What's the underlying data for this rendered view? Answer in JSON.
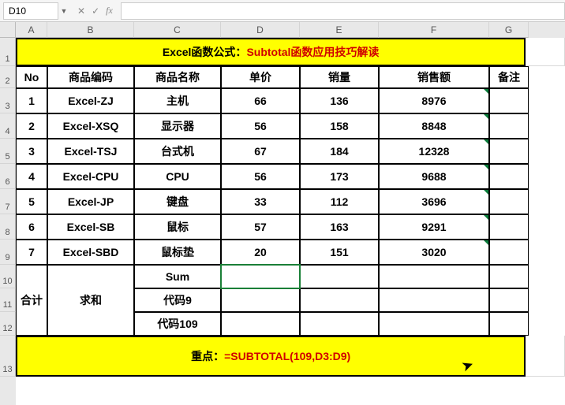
{
  "nameBox": "D10",
  "formulaBarValue": "",
  "cols": [
    "A",
    "B",
    "C",
    "D",
    "E",
    "F",
    "G"
  ],
  "rows": [
    "1",
    "2",
    "3",
    "4",
    "5",
    "6",
    "7",
    "8",
    "9",
    "10",
    "11",
    "12",
    "13"
  ],
  "title": {
    "black": "Excel函数公式：",
    "red": "Subtotal函数应用技巧解读"
  },
  "headers": {
    "no": "No",
    "code": "商品编码",
    "name": "商品名称",
    "price": "单价",
    "qty": "销量",
    "sales": "销售额",
    "remark": "备注"
  },
  "data": [
    {
      "no": "1",
      "code": "Excel-ZJ",
      "name": "主机",
      "price": "66",
      "qty": "136",
      "sales": "8976"
    },
    {
      "no": "2",
      "code": "Excel-XSQ",
      "name": "显示器",
      "price": "56",
      "qty": "158",
      "sales": "8848"
    },
    {
      "no": "3",
      "code": "Excel-TSJ",
      "name": "台式机",
      "price": "67",
      "qty": "184",
      "sales": "12328"
    },
    {
      "no": "4",
      "code": "Excel-CPU",
      "name": "CPU",
      "price": "56",
      "qty": "173",
      "sales": "9688"
    },
    {
      "no": "5",
      "code": "Excel-JP",
      "name": "键盘",
      "price": "33",
      "qty": "112",
      "sales": "3696"
    },
    {
      "no": "6",
      "code": "Excel-SB",
      "name": "鼠标",
      "price": "57",
      "qty": "163",
      "sales": "9291"
    },
    {
      "no": "7",
      "code": "Excel-SBD",
      "name": "鼠标垫",
      "price": "20",
      "qty": "151",
      "sales": "3020"
    }
  ],
  "sumBlock": {
    "merged1": "合计",
    "merged2": "求和",
    "row1": "Sum",
    "row2": "代码9",
    "row3": "代码109"
  },
  "footer": {
    "black": "重点：",
    "red": "=SUBTOTAL(109,D3:D9)"
  },
  "icons": {
    "cancel": "✕",
    "confirm": "✓",
    "fx": "fx"
  },
  "chart_data": {
    "type": "table",
    "title": "Excel函数公式：Subtotal函数应用技巧解读",
    "columns": [
      "No",
      "商品编码",
      "商品名称",
      "单价",
      "销量",
      "销售额",
      "备注"
    ],
    "rows": [
      [
        "1",
        "Excel-ZJ",
        "主机",
        66,
        136,
        8976,
        ""
      ],
      [
        "2",
        "Excel-XSQ",
        "显示器",
        56,
        158,
        8848,
        ""
      ],
      [
        "3",
        "Excel-TSJ",
        "台式机",
        67,
        184,
        12328,
        ""
      ],
      [
        "4",
        "Excel-CPU",
        "CPU",
        56,
        173,
        9688,
        ""
      ],
      [
        "5",
        "Excel-JP",
        "键盘",
        33,
        112,
        3696,
        ""
      ],
      [
        "6",
        "Excel-SB",
        "鼠标",
        57,
        163,
        9291,
        ""
      ],
      [
        "7",
        "Excel-SBD",
        "鼠标垫",
        20,
        151,
        3020,
        ""
      ]
    ],
    "footer_formula": "=SUBTOTAL(109,D3:D9)"
  }
}
